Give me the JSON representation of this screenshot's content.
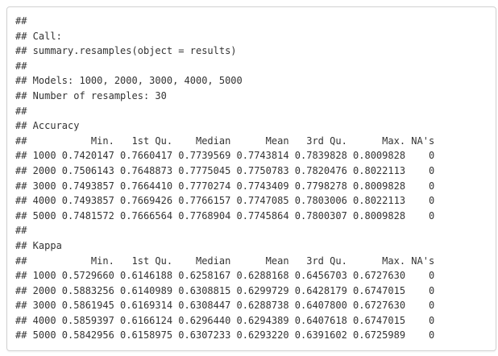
{
  "output": {
    "lines": [
      "##",
      "## Call:",
      "## summary.resamples(object = results)",
      "##",
      "## Models: 1000, 2000, 3000, 4000, 5000",
      "## Number of resamples: 30",
      "##",
      "## Accuracy",
      "##           Min.   1st Qu.    Median      Mean   3rd Qu.      Max. NA's",
      "## 1000 0.7420147 0.7660417 0.7739569 0.7743814 0.7839828 0.8009828    0",
      "## 2000 0.7506143 0.7648873 0.7775045 0.7750783 0.7820476 0.8022113    0",
      "## 3000 0.7493857 0.7664410 0.7770274 0.7743409 0.7798278 0.8009828    0",
      "## 4000 0.7493857 0.7669426 0.7766157 0.7747085 0.7803006 0.8022113    0",
      "## 5000 0.7481572 0.7666564 0.7768904 0.7745864 0.7800307 0.8009828    0",
      "##",
      "## Kappa",
      "##           Min.   1st Qu.    Median      Mean   3rd Qu.      Max. NA's",
      "## 1000 0.5729660 0.6146188 0.6258167 0.6288168 0.6456703 0.6727630    0",
      "## 2000 0.5883256 0.6140989 0.6308815 0.6299729 0.6428179 0.6747015    0",
      "## 3000 0.5861945 0.6169314 0.6308447 0.6288738 0.6407800 0.6727630    0",
      "## 4000 0.5859397 0.6166124 0.6296440 0.6294389 0.6407618 0.6747015    0",
      "## 5000 0.5842956 0.6158975 0.6307233 0.6293220 0.6391602 0.6725989    0"
    ]
  }
}
